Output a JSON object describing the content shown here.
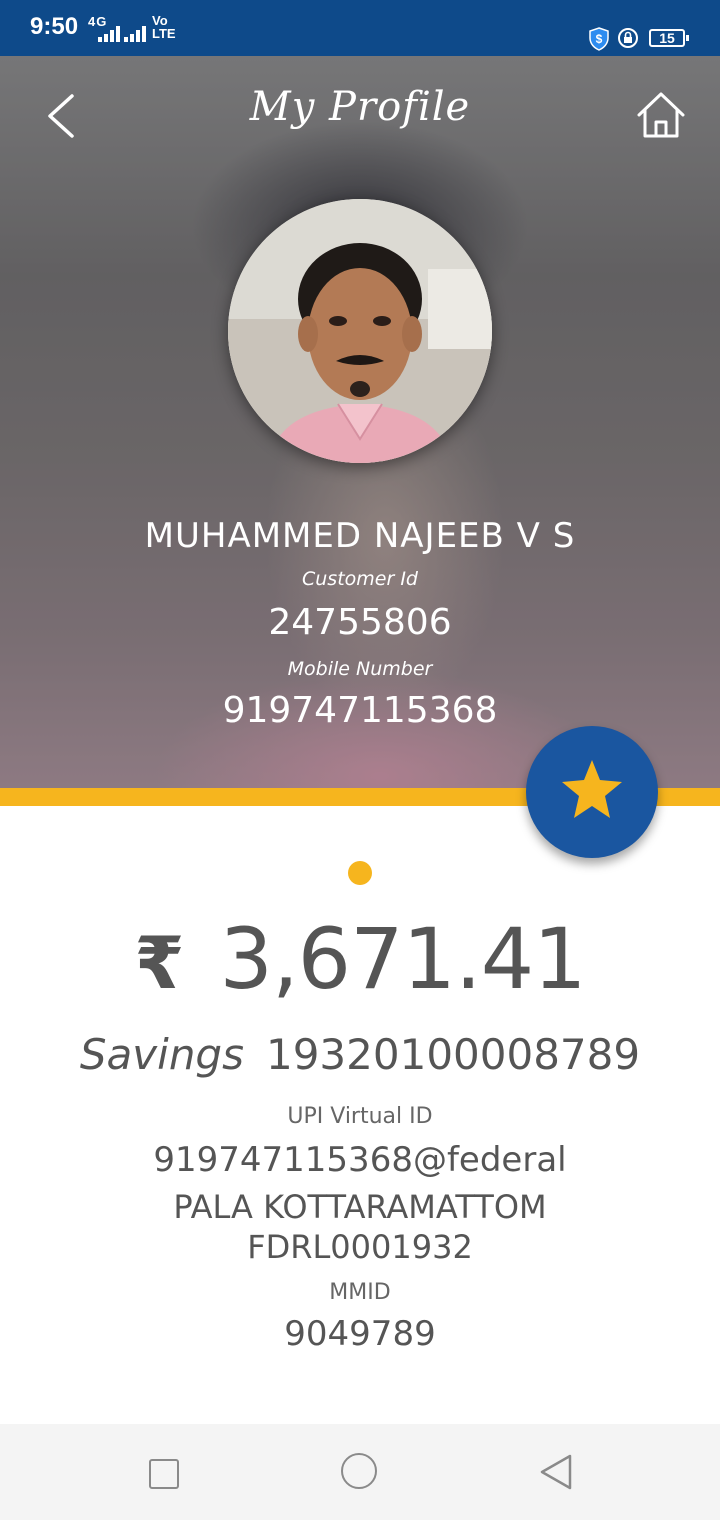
{
  "status_bar": {
    "time": "9:50",
    "network": "4G",
    "volte": "Vo\nLTE",
    "battery": "15"
  },
  "header": {
    "title": "My Profile",
    "back_icon": "chevron-left-icon",
    "home_icon": "home-icon"
  },
  "profile": {
    "name": "MUHAMMED NAJEEB V S",
    "customer_id_label": "Customer Id",
    "customer_id": "24755806",
    "mobile_label": "Mobile Number",
    "mobile": "919747115368"
  },
  "fab_icon": "star-icon",
  "account": {
    "currency_symbol": "₹",
    "balance": "3,671.41",
    "type": "Savings",
    "number": "19320100008789",
    "upi_label": "UPI Virtual ID",
    "upi_id": "919747115368@federal",
    "branch": "PALA KOTTARAMATTOM",
    "ifsc": "FDRL0001932",
    "mmid_label": "MMID",
    "mmid": "9049789"
  },
  "colors": {
    "status_bar": "#0e4a8a",
    "accent_yellow": "#f6b51e",
    "fab_blue": "#1a56a0",
    "text_grey": "#555555"
  },
  "nav_bar": {
    "icons": [
      "recents-square-icon",
      "home-circle-icon",
      "back-triangle-icon"
    ]
  }
}
